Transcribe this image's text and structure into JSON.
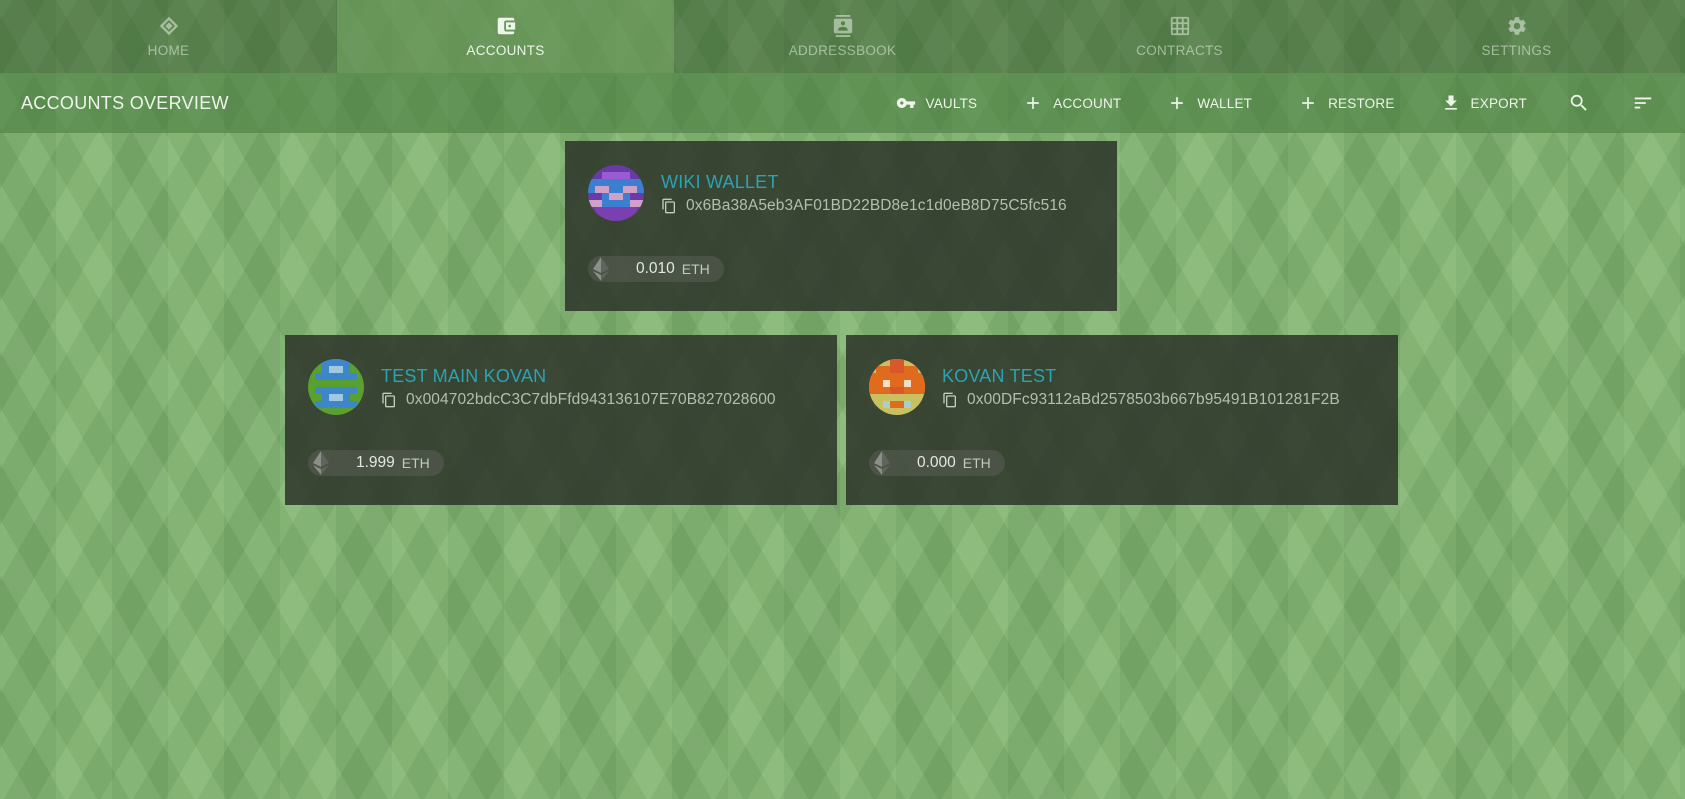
{
  "tabs": [
    {
      "label": "HOME",
      "icon": "home-diamond-icon",
      "active": false
    },
    {
      "label": "ACCOUNTS",
      "icon": "wallet-icon",
      "active": true
    },
    {
      "label": "ADDRESSBOOK",
      "icon": "contact-card-icon",
      "active": false
    },
    {
      "label": "CONTRACTS",
      "icon": "grid-icon",
      "active": false
    },
    {
      "label": "SETTINGS",
      "icon": "gear-icon",
      "active": false
    }
  ],
  "toolbar": {
    "title": "ACCOUNTS OVERVIEW",
    "vaults_label": "VAULTS",
    "account_label": "ACCOUNT",
    "wallet_label": "WALLET",
    "restore_label": "RESTORE",
    "export_label": "EXPORT",
    "search_icon": "search-icon",
    "sort_icon": "sort-icon"
  },
  "accounts": [
    {
      "name": "WIKI WALLET",
      "address": "0x6Ba38A5eb3AF01BD22BD8e1c1d0eB8D75C5fc516",
      "balance": "0.010",
      "unit": "ETH",
      "identicon_colors": [
        "#7a3fb0",
        "#3c7fd0",
        "#d0a0c8",
        "#5a40a8"
      ]
    },
    {
      "name": "TEST MAIN KOVAN",
      "address": "0x004702bdcC3C7dbFfd943136107E70B827028600",
      "balance": "1.999",
      "unit": "ETH",
      "identicon_colors": [
        "#5aa030",
        "#3d86c9",
        "#a0c8e0",
        "#4e8a2a"
      ]
    },
    {
      "name": "KOVAN TEST",
      "address": "0x00DFc93112aBd2578503b667b95491B101281F2B",
      "balance": "0.000",
      "unit": "ETH",
      "identicon_colors": [
        "#e06a1e",
        "#c9c060",
        "#a8d0c8",
        "#d8582a"
      ]
    }
  ],
  "colors": {
    "accent": "#2aa3b3",
    "background": "#7fb46e",
    "card": "#2d342a"
  }
}
